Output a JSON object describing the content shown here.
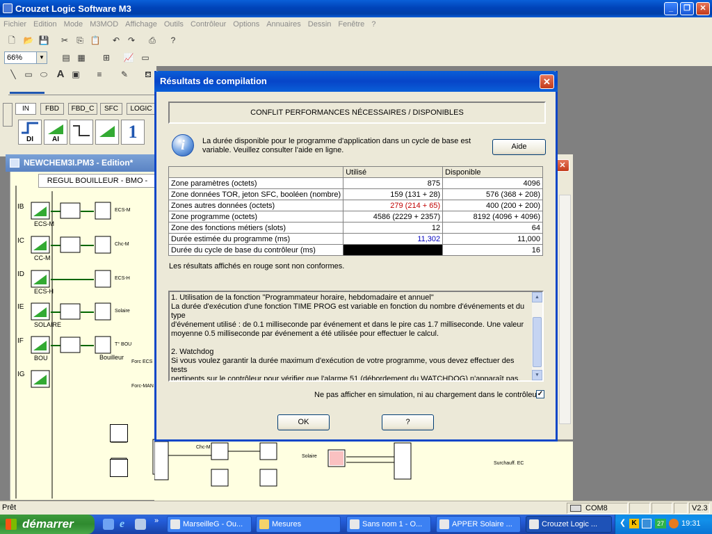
{
  "app": {
    "title": "Crouzet Logic Software M3",
    "menu": [
      "Fichier",
      "Edition",
      "Mode",
      "M3MOD",
      "Affichage",
      "Outils",
      "Contrôleur",
      "Options",
      "Annuaires",
      "Dessin",
      "Fenêtre",
      "?"
    ],
    "zoom": "66%"
  },
  "function_tabs": [
    "IN",
    "FBD",
    "FBD_C",
    "SFC",
    "LOGIC"
  ],
  "function_blocks": [
    "DI",
    "AI"
  ],
  "document": {
    "title": "NEWCHEM3I.PM3 - Edition*",
    "header": "REGUL BOUILLEUR - BMO -",
    "row_labels": [
      "IB",
      "IC",
      "ID",
      "IE",
      "IF",
      "IG"
    ],
    "input_names": [
      "ECS-M",
      "CC-M",
      "ECS-H",
      "SOLAIRE",
      "BOU"
    ],
    "block_labels": [
      "ECS-M",
      "Chc-M",
      "ECS-H",
      "Solaire",
      "T° BOU",
      "Bouilleur",
      "Forc ECS",
      "Forc-MAN",
      "Solaire",
      "Surchauff. EC"
    ]
  },
  "dialog": {
    "title": "Résultats de compilation",
    "header": "CONFLIT PERFORMANCES NÉCESSAIRES / DISPONIBLES",
    "info_line1": "La durée disponible pour le programme d'application dans un cycle de base est",
    "info_line2": "variable. Veuillez consulter l'aide en ligne.",
    "help_label": "Aide",
    "table": {
      "col_used": "Utilisé",
      "col_available": "Disponible",
      "rows": [
        {
          "label": "Zone paramètres (octets)",
          "used": "875",
          "available": "4096"
        },
        {
          "label": "Zone données TOR, jeton SFC, booléen (nombre)",
          "used": "159 (131 + 28)",
          "available": "576 (368 + 208)"
        },
        {
          "label": "Zones autres données (octets)",
          "used": "279 (214 + 65)",
          "available": "400 (200 + 200)"
        },
        {
          "label": "Zone programme (octets)",
          "used": "4586 (2229 + 2357)",
          "available": "8192 (4096 + 4096)"
        },
        {
          "label": "Zone des fonctions métiers (slots)",
          "used": "12",
          "available": "64"
        },
        {
          "label": "Durée estimée du programme (ms)",
          "used": "11,302",
          "available": "11,000"
        },
        {
          "label": "Durée du cycle de base du contrôleur (ms)",
          "used": "",
          "available": "16"
        }
      ]
    },
    "note": "Les résultats affichés en rouge sont non conformes.",
    "details": {
      "p1_line1": "1. Utilisation de la fonction \"Programmateur horaire, hebdomadaire et annuel\"",
      "p1_line2": "La durée d'exécution d'une fonction TIME PROG est variable en fonction du nombre d'événements et du type",
      "p1_line3": "d'événement utilisé : de 0.1 milliseconde par événement et dans le pire cas 1.7 milliseconde. Une valeur",
      "p1_line4": "moyenne 0.5 milliseconde par événement a été utilisée pour effectuer le calcul.",
      "p2_line1": "2. Watchdog",
      "p2_line2": "Si vous voulez garantir la durée maximum d'exécution de votre programme, vous devez effectuer des tests",
      "p2_line3": "pertinents sur le contrôleur pour vérifier que l'alarme 51 (débordement du WATCHDOG) n'apparaît pas."
    },
    "checkbox_label": "Ne pas afficher en simulation, ni au chargement dans le contrôleur.",
    "checkbox_checked": true,
    "ok_label": "OK",
    "question_label": "?",
    "colors": {
      "nonconform": "#c00000",
      "highlight": "#0000c0"
    }
  },
  "statusbar": {
    "text": "Prêt",
    "port": "COM8 (USB)",
    "version": "V2.3"
  },
  "taskbar": {
    "start": "démarrer",
    "buttons": [
      "MarseilleG - Ou...",
      "Mesures",
      "Sans nom 1 - O...",
      "APPER Solaire ...",
      "Crouzet Logic ..."
    ],
    "tray_badge": "27",
    "clock": "19:31"
  }
}
